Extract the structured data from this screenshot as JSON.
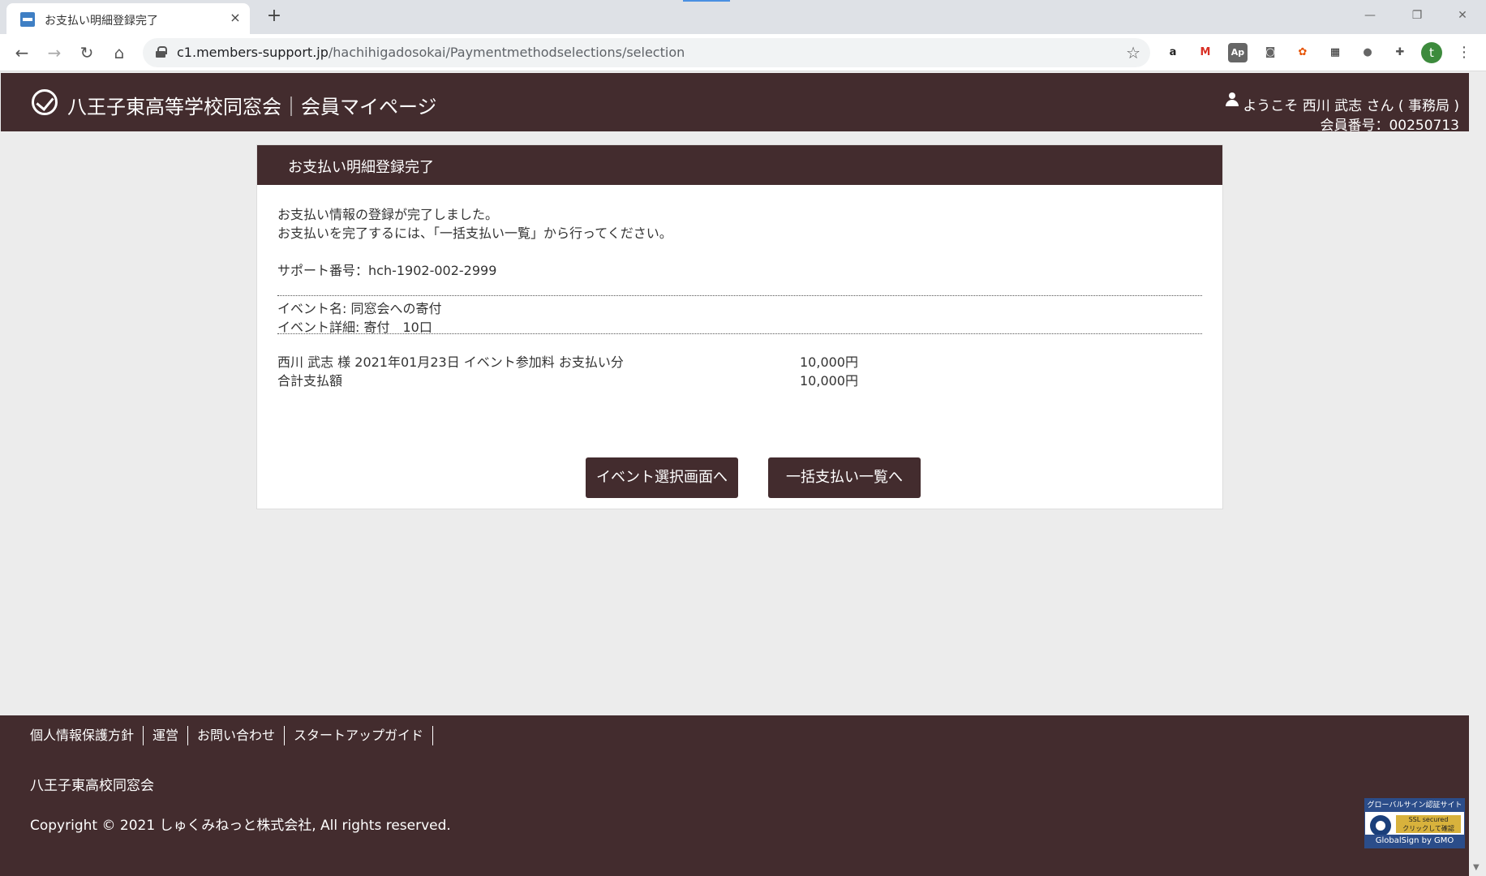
{
  "browser": {
    "tab_title": "お支払い明細登録完了",
    "tab_close": "×",
    "new_tab": "+",
    "url_host": "c1.members-support.jp",
    "url_path": "/hachihigadosokai/Paymentmethodselections/selection",
    "avatar_letter": "t",
    "window_controls": [
      "—",
      "❐",
      "✕"
    ],
    "extensions": [
      "amazon-icon",
      "gmail-icon",
      "adobe-icon",
      "camera-icon",
      "color-wheel-icon",
      "qr-icon",
      "circle-icon",
      "puzzle-icon"
    ]
  },
  "header": {
    "site_title": "八王子東高等学校同窓会｜会員マイページ",
    "welcome": "ようこそ 西川 武志 さん ( 事務局 )",
    "member_number": "会員番号：00250713"
  },
  "card": {
    "title": "お支払い明細登録完了",
    "message_line1": "お支払い情報の登録が完了しました。",
    "message_line2": "お支払いを完了するには、「一括支払い一覧」から行ってください。",
    "support_number": "サポート番号：hch-1902-002-2999",
    "event_name": "イベント名: 同窓会への寄付",
    "event_detail": "イベント詳細: 寄付　10口",
    "line_item_label": "西川 武志 様 2021年01月23日 イベント参加料 お支払い分",
    "line_item_amount": "10,000円",
    "total_label": "合計支払額",
    "total_amount": "10,000円"
  },
  "buttons": {
    "event_select": "イベント選択画面へ",
    "bulk_payment": "一括支払い一覧へ"
  },
  "footer": {
    "links": [
      "個人情報保護方針",
      "運営",
      "お問い合わせ",
      "スタートアップガイド"
    ],
    "org_name": "八王子東高校同窓会",
    "copyright": "Copyright © 2021 しゅくみねっと株式会社, All rights reserved.",
    "ssl_top": "グローバルサイン認証サイト",
    "ssl_middle": "SSL secured\nクリックして確認",
    "ssl_brand": "GlobalSign by GMO"
  },
  "colors": {
    "brand": "#432c2e",
    "background": "#ececec"
  }
}
